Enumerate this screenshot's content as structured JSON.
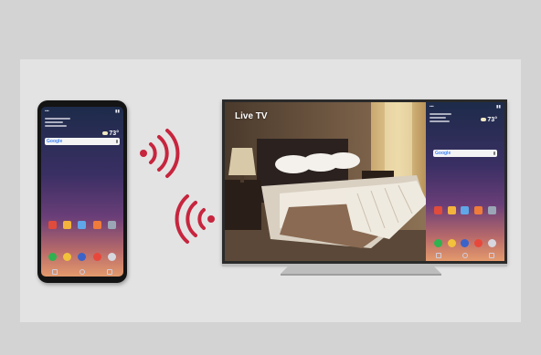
{
  "tv": {
    "live_label": "Live TV"
  },
  "phone_screen": {
    "search_logo": "Google",
    "weather_temp": "73°",
    "app_colors_row1": [
      "#e04b3b",
      "#f3b33c",
      "#5fa7e8",
      "#ef7b3a",
      "#9aa6b5"
    ],
    "app_colors_row2": [
      "#2fb24f",
      "#f2c23a",
      "#3b63c9",
      "#e8483b",
      "#d7d7df"
    ]
  },
  "colors": {
    "wave_red": "#c7253e",
    "background_outer": "#d3d3d3",
    "background_inner": "#e3e3e3"
  }
}
